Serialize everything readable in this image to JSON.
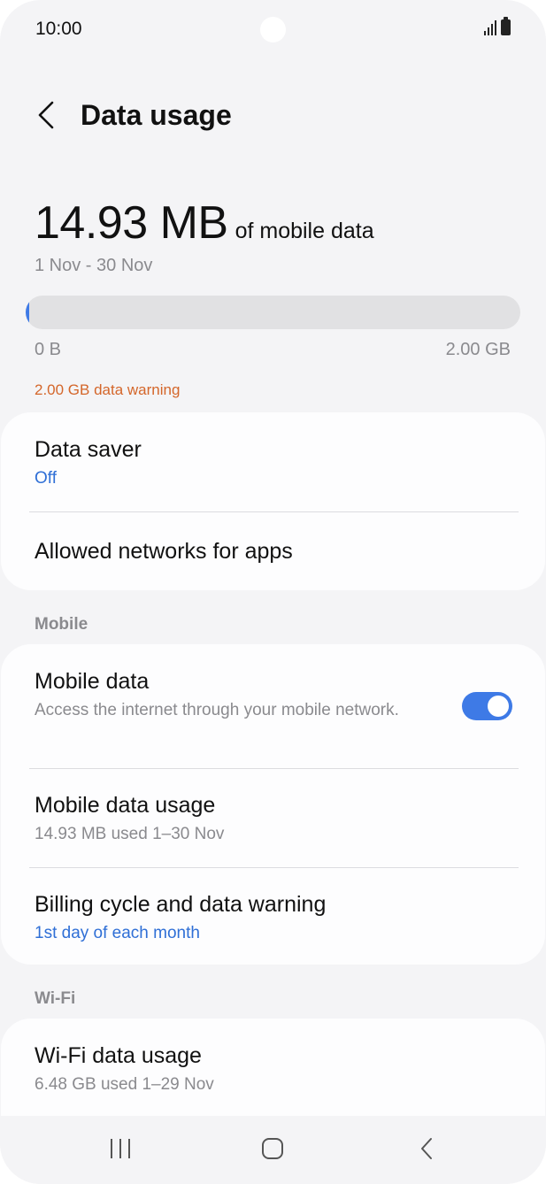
{
  "status_bar": {
    "time": "10:00"
  },
  "header": {
    "title": "Data usage"
  },
  "summary": {
    "amount": "14.93 MB",
    "suffix": "of mobile data",
    "range": "1 Nov - 30 Nov",
    "bar_fraction": 0.0073,
    "bar_min": "0 B",
    "bar_max": "2.00 GB",
    "warning": "2.00 GB data warning"
  },
  "card1": {
    "data_saver": {
      "title": "Data saver",
      "value": "Off"
    },
    "allowed_networks": {
      "title": "Allowed networks for apps"
    }
  },
  "sections": {
    "mobile": "Mobile",
    "wifi": "Wi-Fi"
  },
  "mobile": {
    "mobile_data": {
      "title": "Mobile data",
      "subtitle": "Access the internet through your mobile network.",
      "enabled": true
    },
    "mobile_data_usage": {
      "title": "Mobile data usage",
      "subtitle": "14.93 MB used 1–30 Nov"
    },
    "billing_cycle": {
      "title": "Billing cycle and data warning",
      "value": "1st day of each month"
    }
  },
  "wifi": {
    "wifi_data_usage": {
      "title": "Wi-Fi data usage",
      "subtitle": "6.48 GB used 1–29 Nov"
    }
  },
  "colors": {
    "accent": "#3e7ae6",
    "warning": "#d4662a",
    "link": "#2f6fd6"
  }
}
